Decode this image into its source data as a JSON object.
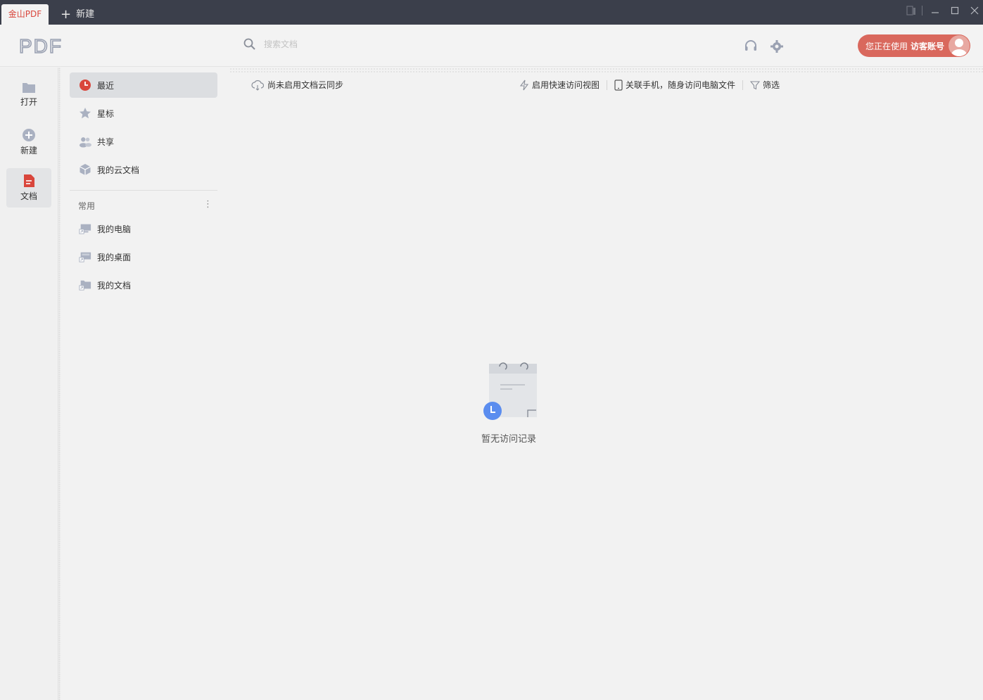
{
  "titlebar": {
    "app_tab": "金山PDF",
    "new_tab": "新建"
  },
  "header": {
    "logo_text": "PDF",
    "search_placeholder": "搜索文档",
    "account": {
      "prefix": "您正在使用",
      "name": "访客账号"
    }
  },
  "rail": {
    "items": [
      {
        "label": "打开",
        "icon": "folder-icon"
      },
      {
        "label": "新建",
        "icon": "plus-circle-icon"
      },
      {
        "label": "文档",
        "icon": "document-icon"
      }
    ]
  },
  "nav": {
    "items": [
      {
        "label": "最近",
        "icon": "clock-icon"
      },
      {
        "label": "星标",
        "icon": "star-icon"
      },
      {
        "label": "共享",
        "icon": "people-icon"
      },
      {
        "label": "我的云文档",
        "icon": "cube-icon"
      }
    ],
    "group_title": "常用",
    "group_items": [
      {
        "label": "我的电脑",
        "icon": "computer-shortcut-icon"
      },
      {
        "label": "我的桌面",
        "icon": "desktop-shortcut-icon"
      },
      {
        "label": "我的文档",
        "icon": "folder-shortcut-icon"
      }
    ]
  },
  "toolbar": {
    "cloud_sync": "尚未启用文档云同步",
    "quick_view": "启用快速访问视图",
    "link_phone": "关联手机，随身访问电脑文件",
    "filter": "筛选"
  },
  "empty_state": {
    "message": "暂无访问记录"
  },
  "colors": {
    "titlebar_bg": "#3b3f4b",
    "accent_red": "#d9463c",
    "account_btn": "#d9685d",
    "clock_blue": "#5b8def"
  }
}
